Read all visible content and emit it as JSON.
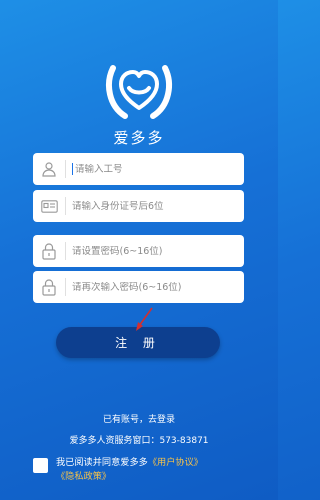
{
  "app": {
    "name": "爱多多"
  },
  "form": {
    "employee_id": {
      "placeholder": "请输入工号"
    },
    "id_card": {
      "placeholder": "请输入身份证号后6位"
    },
    "password": {
      "placeholder": "请设置密码(6~16位)"
    },
    "password_confirm": {
      "placeholder": "请再次输入密码(6~16位)"
    },
    "register_label": "注 册"
  },
  "footer": {
    "login_link": "已有账号，去登录",
    "hr_window": "爱多多人资服务窗口：573-83871",
    "agreement_prefix": "我已阅读并同意爱多多",
    "user_agreement": "《用户协议》",
    "privacy_policy": "《隐私政策》"
  },
  "colors": {
    "background": "#1670d6",
    "button": "#0d3f8f",
    "link": "#f6c24a"
  },
  "icons": [
    "app-logo-heart",
    "user-icon",
    "id-card-icon",
    "lock-icon",
    "lock-icon"
  ]
}
